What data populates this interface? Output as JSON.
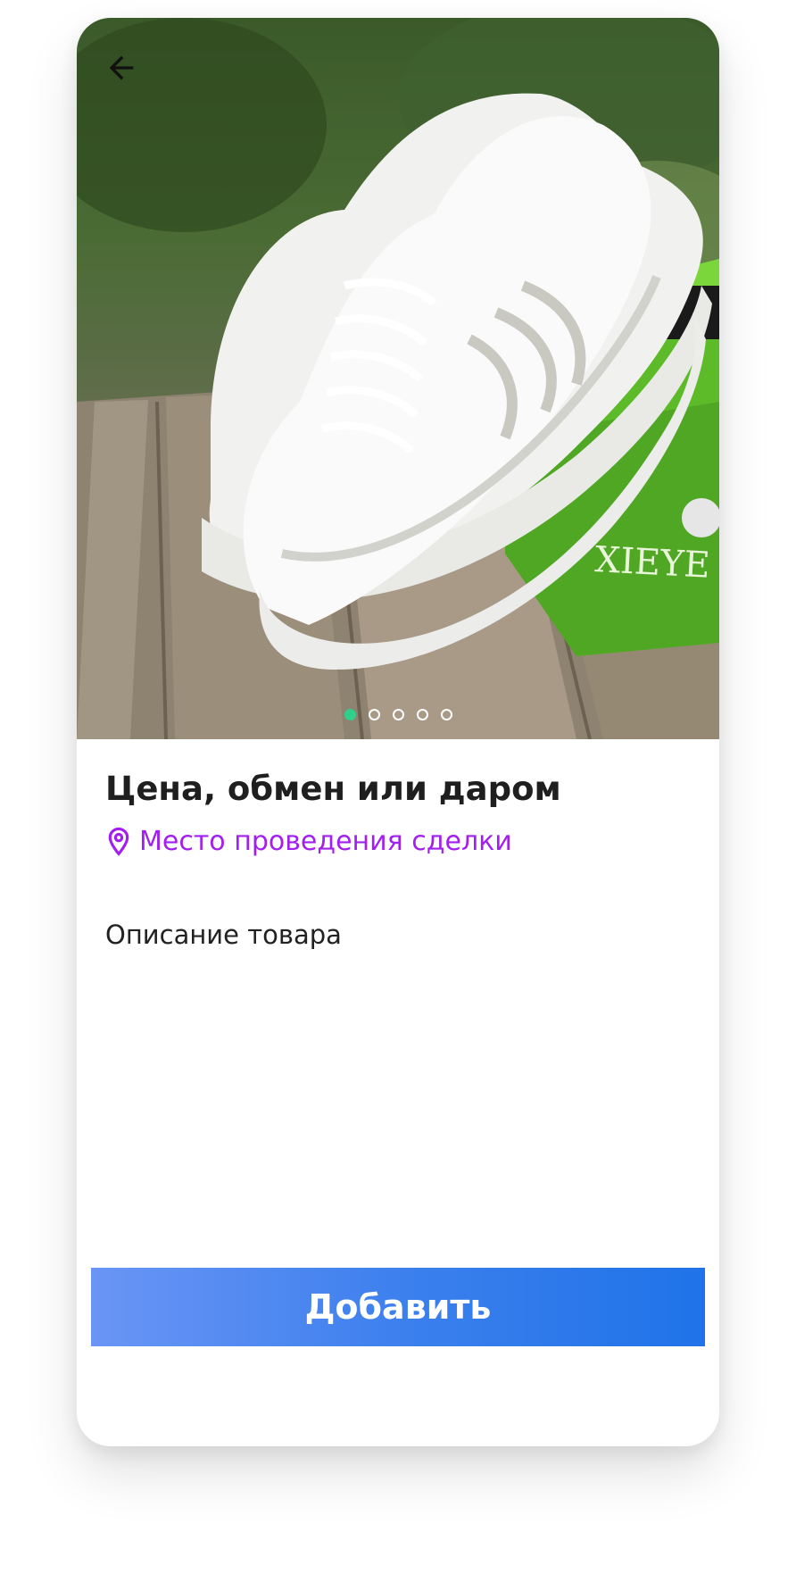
{
  "product": {
    "title": "Цена, обмен или даром",
    "location_label": "Место проведения сделки",
    "description": "Описание товара",
    "photo_count": 5,
    "active_photo": 1
  },
  "actions": {
    "add_label": "Добавить"
  },
  "icons": {
    "back": "arrow-left-icon",
    "location": "map-pin-icon"
  },
  "colors": {
    "accent": "#a31ff0",
    "active_dot": "#2fd08c",
    "button_start": "#6a95f5",
    "button_end": "#1f73e8"
  }
}
